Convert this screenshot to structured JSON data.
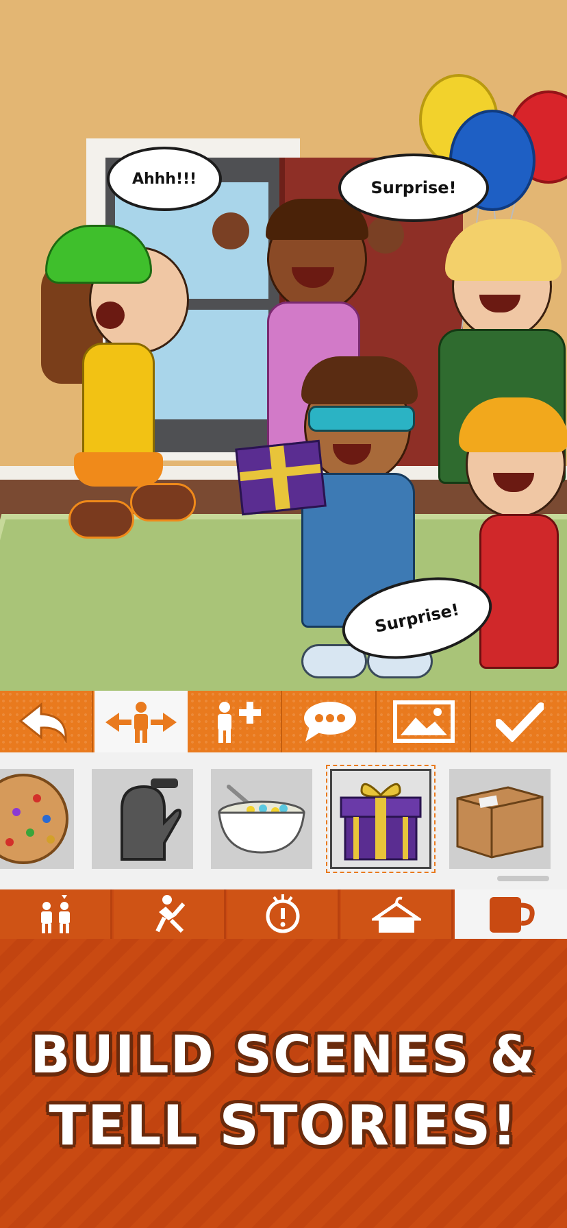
{
  "scene": {
    "bubbles": {
      "left": "Ahhh!!!",
      "top_right": "Surprise!",
      "bottom": "Surprise!"
    }
  },
  "toolbar": {
    "tools": [
      {
        "name": "undo",
        "icon": "undo-arrow-icon"
      },
      {
        "name": "move",
        "icon": "move-character-icon",
        "active": true
      },
      {
        "name": "add-character",
        "icon": "add-character-icon"
      },
      {
        "name": "speech",
        "icon": "speech-bubble-icon"
      },
      {
        "name": "background",
        "icon": "image-icon"
      },
      {
        "name": "done",
        "icon": "checkmark-icon"
      }
    ]
  },
  "tray": {
    "items": [
      {
        "name": "cookie",
        "icon": "cookie-icon"
      },
      {
        "name": "oven-mitt",
        "icon": "oven-mitt-icon"
      },
      {
        "name": "cereal-bowl",
        "icon": "cereal-bowl-icon"
      },
      {
        "name": "gift-box",
        "icon": "gift-box-icon",
        "selected": true
      },
      {
        "name": "cardboard-box",
        "icon": "cardboard-box-icon"
      }
    ]
  },
  "categories": [
    {
      "name": "characters",
      "icon": "characters-icon"
    },
    {
      "name": "poses",
      "icon": "pose-icon"
    },
    {
      "name": "expressions",
      "icon": "expression-icon"
    },
    {
      "name": "clothing",
      "icon": "hanger-icon"
    },
    {
      "name": "props",
      "icon": "mug-icon",
      "active": true
    }
  ],
  "promo": {
    "line1": "BUILD SCENES &",
    "line2": "TELL STORIES!"
  },
  "colors": {
    "toolbar_orange": "#e97a1e",
    "promo_red": "#c94a12",
    "accent_purple": "#5a2d91",
    "ribbon_gold": "#e8c43a"
  }
}
